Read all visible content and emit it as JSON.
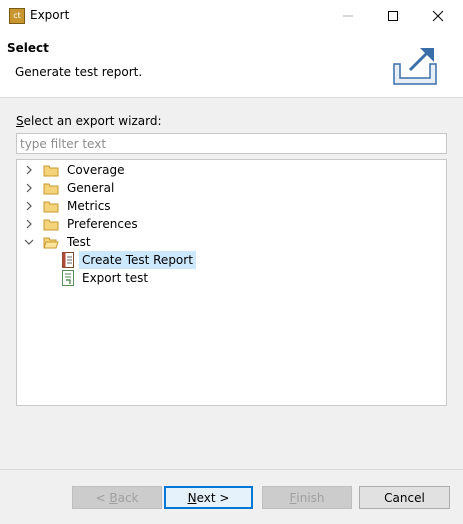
{
  "window": {
    "title": "Export",
    "app_icon_text": "ct"
  },
  "header": {
    "title": "Select",
    "description": "Generate test report.",
    "image_icon": "export-wizard-banner-icon"
  },
  "filter": {
    "label": "elect an export wizard:",
    "label_mnemonic": "S",
    "placeholder": "type filter text",
    "value": ""
  },
  "tree": {
    "items": [
      {
        "label": "Coverage",
        "expanded": false,
        "icon": "folder-icon"
      },
      {
        "label": "General",
        "expanded": false,
        "icon": "folder-icon"
      },
      {
        "label": "Metrics",
        "expanded": false,
        "icon": "folder-icon"
      },
      {
        "label": "Preferences",
        "expanded": false,
        "icon": "folder-icon"
      },
      {
        "label": "Test",
        "expanded": true,
        "icon": "folder-open-icon",
        "children": [
          {
            "label": "Create Test Report",
            "selected": true,
            "icon": "test-report-icon"
          },
          {
            "label": "Export test",
            "selected": false,
            "icon": "export-test-icon"
          }
        ]
      }
    ]
  },
  "buttons": {
    "back": {
      "prefix": "< ",
      "mnemonic": "B",
      "rest": "ack",
      "enabled": false
    },
    "next": {
      "mnemonic": "N",
      "rest": "ext >",
      "enabled": true
    },
    "finish": {
      "mnemonic": "F",
      "rest": "inish",
      "enabled": false
    },
    "cancel": {
      "label": "Cancel",
      "enabled": true
    }
  }
}
